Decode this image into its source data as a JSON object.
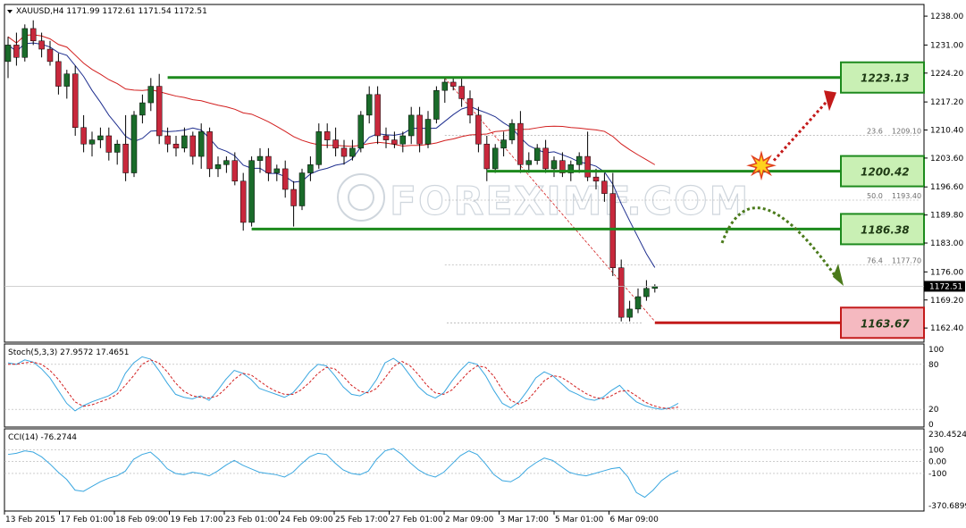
{
  "chart_title": "XAUUSD,H4  1171.99 1172.61 1171.54 1172.51",
  "watermark": "FOREXIMF.COM",
  "colors": {
    "bull_body": "#1a6b2a",
    "bear_body": "#c8283c",
    "ma_fast": "#1f2f8f",
    "ma_slow": "#d21e1e",
    "stoch_main": "#3aa7e0",
    "stoch_signal": "#d21e1e",
    "cci": "#3aa7e0",
    "support_line": "#1d8a1d",
    "low_line": "#c31a1a",
    "box_green": "#c9f0b4",
    "box_red": "#f5b9c0",
    "up_arrow": "#c31a1a",
    "down_arrow": "#4a7a1a"
  },
  "chart_data": [
    {
      "type": "candlestick",
      "title": "XAUUSD,H4",
      "price_label": "1172.51",
      "ylim": [
        1159.4,
        1240.4
      ],
      "price_ticks": [
        "1238.00",
        "1231.00",
        "1224.20",
        "1217.20",
        "1210.40",
        "1203.60",
        "1196.60",
        "1189.80",
        "1183.00",
        "1176.00",
        "1169.20",
        "1162.40"
      ],
      "x_labels": [
        "13 Feb 2015",
        "17 Feb 01:00",
        "18 Feb 09:00",
        "19 Feb 17:00",
        "23 Feb 01:00",
        "24 Feb 09:00",
        "25 Feb 17:00",
        "27 Feb 01:00",
        "2 Mar 09:00",
        "3 Mar 17:00",
        "5 Mar 01:00",
        "6 Mar 09:00"
      ],
      "candles": [
        [
          1227,
          1233,
          1223,
          1231
        ],
        [
          1231,
          1234,
          1226,
          1228
        ],
        [
          1228,
          1236,
          1227,
          1235
        ],
        [
          1235,
          1237,
          1231,
          1232
        ],
        [
          1232,
          1234,
          1228,
          1230
        ],
        [
          1230,
          1232,
          1226,
          1227
        ],
        [
          1227,
          1229,
          1219,
          1221
        ],
        [
          1221,
          1225,
          1218,
          1224
        ],
        [
          1224,
          1226,
          1209,
          1211
        ],
        [
          1211,
          1214,
          1205,
          1207
        ],
        [
          1207,
          1210,
          1204,
          1208
        ],
        [
          1208,
          1211,
          1206,
          1209
        ],
        [
          1209,
          1211,
          1203,
          1205
        ],
        [
          1205,
          1208,
          1202,
          1207
        ],
        [
          1207,
          1214,
          1198,
          1200
        ],
        [
          1200,
          1215,
          1199,
          1214
        ],
        [
          1214,
          1219,
          1212,
          1217
        ],
        [
          1217,
          1223,
          1215,
          1221
        ],
        [
          1221,
          1224,
          1207,
          1209
        ],
        [
          1209,
          1211,
          1205,
          1207
        ],
        [
          1207,
          1209,
          1204,
          1206
        ],
        [
          1206,
          1211,
          1205,
          1209
        ],
        [
          1209,
          1210,
          1202,
          1204
        ],
        [
          1204,
          1212,
          1201,
          1210
        ],
        [
          1210,
          1211,
          1199,
          1201
        ],
        [
          1201,
          1204,
          1199,
          1202
        ],
        [
          1202,
          1204,
          1200,
          1203
        ],
        [
          1203,
          1205,
          1197,
          1198
        ],
        [
          1198,
          1200,
          1186,
          1188
        ],
        [
          1188,
          1204,
          1187,
          1203
        ],
        [
          1203,
          1206,
          1200,
          1204
        ],
        [
          1204,
          1206,
          1198,
          1200
        ],
        [
          1200,
          1202,
          1198,
          1201
        ],
        [
          1201,
          1203,
          1194,
          1196
        ],
        [
          1196,
          1198,
          1187,
          1192
        ],
        [
          1192,
          1201,
          1191,
          1200
        ],
        [
          1200,
          1204,
          1198,
          1202
        ],
        [
          1202,
          1212,
          1201,
          1210
        ],
        [
          1210,
          1212,
          1206,
          1208
        ],
        [
          1208,
          1211,
          1204,
          1206
        ],
        [
          1206,
          1208,
          1202,
          1204
        ],
        [
          1204,
          1208,
          1203,
          1206
        ],
        [
          1206,
          1215,
          1205,
          1214
        ],
        [
          1214,
          1221,
          1212,
          1219
        ],
        [
          1219,
          1221,
          1207,
          1209
        ],
        [
          1209,
          1211,
          1206,
          1208
        ],
        [
          1208,
          1210,
          1206,
          1207
        ],
        [
          1207,
          1210,
          1205,
          1209
        ],
        [
          1209,
          1216,
          1207,
          1214
        ],
        [
          1214,
          1216,
          1205,
          1207
        ],
        [
          1207,
          1215,
          1206,
          1213
        ],
        [
          1213,
          1221,
          1212,
          1220
        ],
        [
          1220,
          1223,
          1217,
          1222
        ],
        [
          1222,
          1223,
          1220,
          1221
        ],
        [
          1221,
          1223,
          1216,
          1218
        ],
        [
          1218,
          1220,
          1212,
          1214
        ],
        [
          1214,
          1216,
          1205,
          1207
        ],
        [
          1207,
          1209,
          1198,
          1201
        ],
        [
          1201,
          1207,
          1200,
          1206
        ],
        [
          1206,
          1210,
          1204,
          1208
        ],
        [
          1208,
          1213,
          1207,
          1212
        ],
        [
          1212,
          1215,
          1200,
          1202
        ],
        [
          1202,
          1205,
          1200,
          1203
        ],
        [
          1203,
          1207,
          1202,
          1206
        ],
        [
          1206,
          1208,
          1200,
          1201
        ],
        [
          1201,
          1204,
          1199,
          1203
        ],
        [
          1203,
          1205,
          1199,
          1200
        ],
        [
          1200,
          1203,
          1198,
          1202
        ],
        [
          1202,
          1205,
          1200,
          1204
        ],
        [
          1204,
          1210,
          1198,
          1199
        ],
        [
          1199,
          1201,
          1196,
          1198
        ],
        [
          1198,
          1200,
          1193,
          1195
        ],
        [
          1195,
          1200,
          1175,
          1177
        ],
        [
          1177,
          1179,
          1164,
          1165
        ],
        [
          1165,
          1169,
          1164,
          1167
        ],
        [
          1167,
          1172,
          1166,
          1170
        ],
        [
          1170,
          1174,
          1169,
          1172
        ],
        [
          1172,
          1173,
          1171,
          1172.5
        ]
      ],
      "levels": [
        {
          "label": "1223.13",
          "price": 1223.13,
          "kind": "resistance"
        },
        {
          "label": "1200.42",
          "price": 1200.42,
          "kind": "support"
        },
        {
          "label": "1186.38",
          "price": 1186.38,
          "kind": "support"
        },
        {
          "label": "1163.67",
          "price": 1163.67,
          "kind": "low"
        }
      ],
      "fib_levels": [
        {
          "ratio": "23.6",
          "value": "1209.10",
          "price": 1209.1
        },
        {
          "ratio": "50.0",
          "value": "1193.40",
          "price": 1193.4
        },
        {
          "ratio": "76.4",
          "value": "1177.70",
          "price": 1177.7
        }
      ]
    },
    {
      "type": "line",
      "title": "Stoch(5,3,3) 27.9572 17.4651",
      "ylim": [
        0,
        100
      ],
      "ticks": [
        "100",
        "80",
        "20",
        "0"
      ],
      "series": [
        {
          "name": "main",
          "values": [
            82,
            80,
            86,
            83,
            74,
            62,
            45,
            28,
            18,
            25,
            30,
            34,
            38,
            45,
            68,
            82,
            90,
            87,
            72,
            55,
            40,
            36,
            34,
            38,
            32,
            45,
            60,
            72,
            68,
            60,
            48,
            44,
            40,
            36,
            42,
            55,
            70,
            80,
            78,
            65,
            50,
            40,
            38,
            44,
            60,
            82,
            88,
            80,
            65,
            50,
            40,
            35,
            42,
            58,
            72,
            83,
            80,
            65,
            45,
            28,
            22,
            30,
            45,
            62,
            70,
            65,
            55,
            45,
            40,
            34,
            32,
            36,
            45,
            52,
            40,
            30,
            25,
            22,
            20,
            22,
            28
          ]
        },
        {
          "name": "signal",
          "values": [
            80,
            80,
            82,
            83,
            80,
            72,
            60,
            45,
            30,
            24,
            26,
            30,
            34,
            40,
            52,
            65,
            80,
            86,
            82,
            70,
            55,
            44,
            38,
            36,
            35,
            38,
            48,
            60,
            68,
            66,
            58,
            50,
            44,
            40,
            40,
            46,
            56,
            68,
            76,
            74,
            64,
            52,
            44,
            42,
            48,
            62,
            77,
            84,
            78,
            66,
            52,
            42,
            40,
            46,
            58,
            70,
            78,
            76,
            64,
            46,
            32,
            27,
            32,
            45,
            58,
            65,
            63,
            56,
            48,
            41,
            36,
            34,
            38,
            44,
            45,
            38,
            30,
            25,
            22,
            21,
            23
          ]
        }
      ]
    },
    {
      "type": "line",
      "title": "CCI(14) -76.2744",
      "ylim": [
        -370.6899,
        230.4524
      ],
      "ticks": [
        "230.4524",
        "100",
        "0.00",
        "-100",
        "-370.6899"
      ],
      "series": [
        {
          "name": "cci",
          "values": [
            60,
            70,
            90,
            80,
            40,
            -20,
            -90,
            -150,
            -240,
            -250,
            -210,
            -170,
            -140,
            -120,
            -80,
            20,
            60,
            80,
            20,
            -60,
            -100,
            -110,
            -90,
            -100,
            -120,
            -80,
            -30,
            10,
            -30,
            -60,
            -90,
            -100,
            -110,
            -130,
            -90,
            -20,
            40,
            70,
            60,
            -10,
            -70,
            -100,
            -110,
            -80,
            20,
            90,
            110,
            60,
            -10,
            -70,
            -110,
            -130,
            -90,
            -20,
            50,
            90,
            60,
            -20,
            -110,
            -160,
            -170,
            -130,
            -60,
            -10,
            30,
            10,
            -40,
            -90,
            -110,
            -120,
            -100,
            -80,
            -60,
            -50,
            -130,
            -260,
            -300,
            -240,
            -160,
            -110,
            -76.27
          ]
        }
      ]
    }
  ]
}
